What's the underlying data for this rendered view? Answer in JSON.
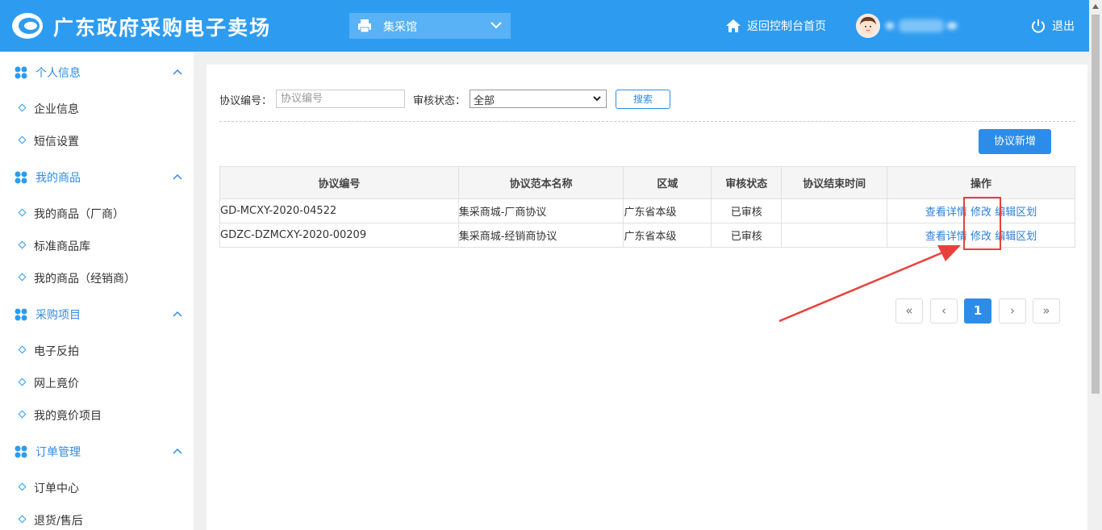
{
  "header": {
    "brand": "广东政府采购电子卖场",
    "hall_label": "集采馆",
    "home_label": "返回控制台首页",
    "logout_label": "退出",
    "colors": {
      "header_bg": "#2d9cf0",
      "accent": "#2d8ce8",
      "highlight": "#e8413b"
    },
    "icons": {
      "home": "home-icon",
      "logout": "power-icon",
      "hall": "printer-icon"
    }
  },
  "sidebar": {
    "sections": [
      {
        "label": "个人信息",
        "items": [
          "企业信息",
          "短信设置"
        ]
      },
      {
        "label": "我的商品",
        "items": [
          "我的商品（厂商）",
          "标准商品库",
          "我的商品（经销商）"
        ]
      },
      {
        "label": "采购项目",
        "items": [
          "电子反拍",
          "网上竟价",
          "我的竟价项目"
        ]
      },
      {
        "label": "订单管理",
        "items": [
          "订单中心",
          "退货/售后"
        ]
      }
    ]
  },
  "filters": {
    "protocol_no_label": "协议编号：",
    "protocol_no_placeholder": "协议编号",
    "status_label": "审核状态：",
    "status_value": "全部",
    "search_label": "搜索"
  },
  "actions": {
    "add_label": "协议新增"
  },
  "table": {
    "headers": [
      "协议编号",
      "协议范本名称",
      "区域",
      "审核状态",
      "协议结束时间",
      "操作"
    ],
    "rows": [
      {
        "no": "GD-MCXY-2020-04522",
        "template": "集采商城-厂商协议",
        "region": "广东省本级",
        "status": "已审核",
        "end_time": "",
        "op_detail": "查看详情",
        "op_edit": "修改",
        "op_region": "编辑区划"
      },
      {
        "no": "GDZC-DZMCXY-2020-00209",
        "template": "集采商城-经销商协议",
        "region": "广东省本级",
        "status": "已审核",
        "end_time": "",
        "op_detail": "查看详情",
        "op_edit": "修改",
        "op_region": "编辑区划"
      }
    ]
  },
  "pagination": {
    "first": "«",
    "prev": "‹",
    "current": "1",
    "next": "›",
    "last": "»"
  }
}
